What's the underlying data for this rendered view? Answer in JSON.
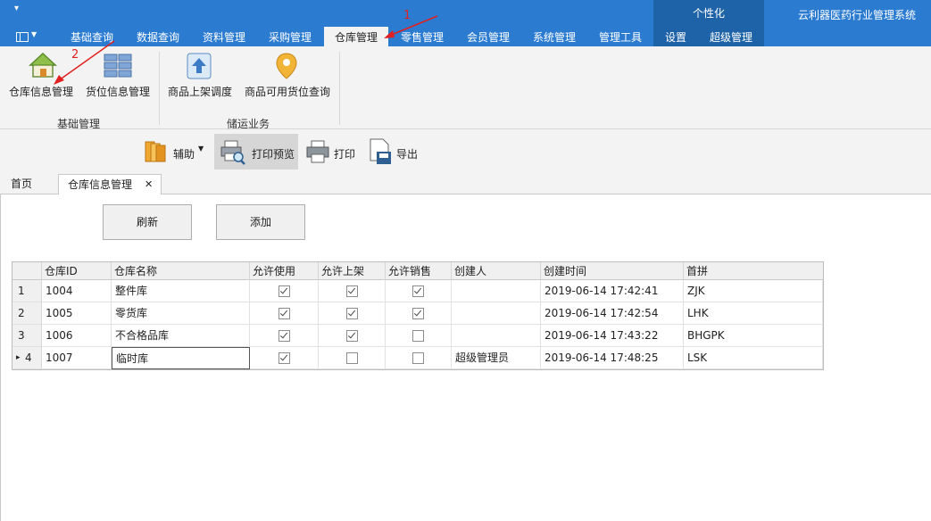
{
  "app": {
    "title": "云利器医药行业管理系统",
    "context_group": "个性化",
    "quick_access": "▾"
  },
  "ribbon_tabs": [
    {
      "label": "基础查询",
      "active": false
    },
    {
      "label": "数据查询",
      "active": false
    },
    {
      "label": "资料管理",
      "active": false
    },
    {
      "label": "采购管理",
      "active": false
    },
    {
      "label": "仓库管理",
      "active": true
    },
    {
      "label": "零售管理",
      "active": false
    },
    {
      "label": "会员管理",
      "active": false
    },
    {
      "label": "系统管理",
      "active": false
    },
    {
      "label": "管理工具",
      "active": false
    },
    {
      "label": "设置",
      "active": false
    },
    {
      "label": "超级管理",
      "active": false
    }
  ],
  "ribbon_groups": [
    {
      "label": "基础管理",
      "buttons": [
        {
          "label": "仓库信息管理",
          "icon": "warehouse-house-icon"
        },
        {
          "label": "货位信息管理",
          "icon": "shelf-grid-icon"
        }
      ]
    },
    {
      "label": "储运业务",
      "buttons": [
        {
          "label": "商品上架调度",
          "icon": "upload-arrow-icon"
        },
        {
          "label": "商品可用货位查询",
          "icon": "location-pin-icon"
        }
      ]
    }
  ],
  "toolbar": {
    "assist": "辅助",
    "print_preview": "打印预览",
    "print": "打印",
    "export": "导出"
  },
  "doc_tabs": {
    "home": "首页",
    "active": "仓库信息管理",
    "close": "✕"
  },
  "actions": {
    "refresh": "刷新",
    "add": "添加"
  },
  "grid": {
    "columns": [
      "仓库ID",
      "仓库名称",
      "允许使用",
      "允许上架",
      "允许销售",
      "创建人",
      "创建时间",
      "首拼"
    ],
    "rows": [
      {
        "index": "1",
        "id": "1004",
        "name": "整件库",
        "use": true,
        "shelf": true,
        "sale": true,
        "creator": "",
        "created": "2019-06-14 17:42:41",
        "pinyin": "ZJK"
      },
      {
        "index": "2",
        "id": "1005",
        "name": "零货库",
        "use": true,
        "shelf": true,
        "sale": true,
        "creator": "",
        "created": "2019-06-14 17:42:54",
        "pinyin": "LHK"
      },
      {
        "index": "3",
        "id": "1006",
        "name": "不合格品库",
        "use": true,
        "shelf": true,
        "sale": false,
        "creator": "",
        "created": "2019-06-14 17:43:22",
        "pinyin": "BHGPK"
      },
      {
        "index": "4",
        "id": "1007",
        "name": "临时库",
        "use": true,
        "shelf": false,
        "sale": false,
        "creator": "超级管理员",
        "created": "2019-06-14 17:48:25",
        "pinyin": "LSK"
      }
    ],
    "current_row_marker": "▸"
  },
  "annotations": {
    "step1": "1",
    "step2": "2",
    "color": "#e02020"
  }
}
